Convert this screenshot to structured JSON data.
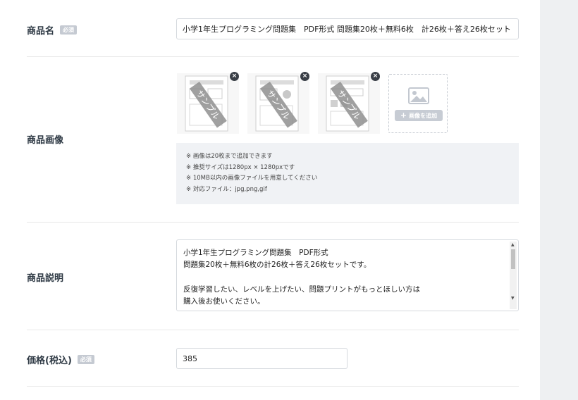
{
  "name_field": {
    "label": "商品名",
    "badge": "必須",
    "value": "小学1年生プログラミング問題集　PDF形式  問題集20枚＋無料6枚　計26枚＋答え26枚セット"
  },
  "image_field": {
    "label": "商品画像",
    "thumbnails": [
      {
        "overlay": "サンプル",
        "remove_glyph": "×"
      },
      {
        "overlay": "サンプル",
        "remove_glyph": "×"
      },
      {
        "overlay": "サンプル",
        "remove_glyph": "×"
      }
    ],
    "add_button_label": "画像を追加",
    "add_glyph": "+",
    "notes": [
      "※ 画像は20枚まで追加できます",
      "※ 推奨サイズは1280px × 1280pxです",
      "※ 10MB以内の画像ファイルを用意してください",
      "※ 対応ファイル：jpg,png,gif"
    ]
  },
  "description_field": {
    "label": "商品説明",
    "lines": [
      "小学1年生プログラミング問題集　PDF形式",
      "問題集20枚＋無料6枚の計26枚＋答え26枚セットです。",
      "",
      "反復学習したい、レベルを上げたい、問題プリントがもっとほしい方は",
      "購入後お使いください。"
    ]
  },
  "price_field": {
    "label": "価格(税込)",
    "badge": "必須",
    "value": "385"
  },
  "icons": {
    "remove": "close-circle-icon",
    "add_image": "image-placeholder-icon",
    "plus": "plus-icon"
  },
  "colors": {
    "label": "#2f3a45",
    "badge": "#c5cad2",
    "notes_bg": "#f0f2f5",
    "remove_btn": "#3a3f47"
  }
}
